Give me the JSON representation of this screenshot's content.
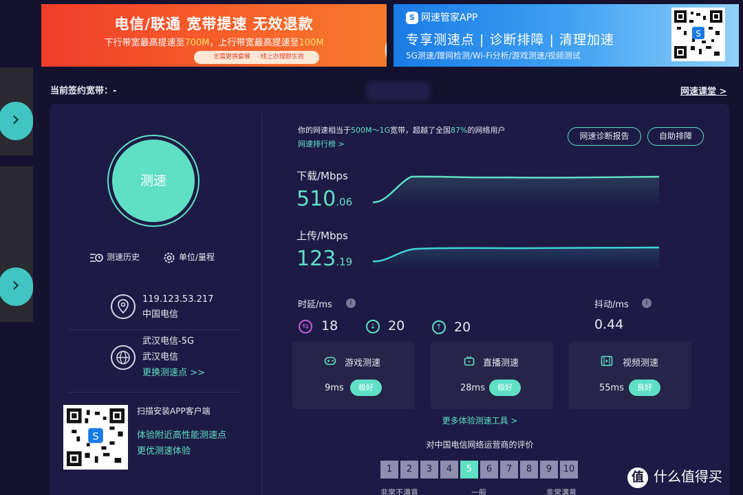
{
  "banner_left": {
    "title": "电信/联通 宽带提速 无效退款",
    "sub_prefix": "下行带宽最高提速至",
    "sub_down": "700M",
    "sub_mid": "，上行带宽最高提速至",
    "sub_up": "100M",
    "chips": "· 无需更换套餐　· 线上办理即生效"
  },
  "banner_right": {
    "app_name": "网速管家APP",
    "headline": "专享测速点 | 诊断排障 | 清理加速",
    "sub": "5G测速/蹭网检测/Wi-Fi分析/游戏测速/视频测试"
  },
  "header": {
    "contract": "当前签约宽带：-",
    "course_link": "网速课堂 >"
  },
  "left": {
    "start_button": "测速",
    "history": "测速历史",
    "unit_range": "单位/量程",
    "ip": "119.123.53.217",
    "isp": "中国电信",
    "server_name": "武汉电信-5G",
    "server_isp": "武汉电信",
    "change_server": "更换测速点 >>",
    "scan_title": "扫描安装APP客户端",
    "scan_line1": "体验附近高性能测速点",
    "scan_line2": "更优测速体验"
  },
  "summary": {
    "pre": "你的网速相当于",
    "band": "500M～1G",
    "mid": "宽带，超越了全国",
    "pct": "87%",
    "post": "的网络用户",
    "rank_link": "网速排行榜 >",
    "report_button": "网速诊断报告",
    "fix_button": "自助排障"
  },
  "download": {
    "label": "下载/Mbps",
    "int": "510",
    "dec": ".06"
  },
  "upload": {
    "label": "上传/Mbps",
    "int": "123",
    "dec": ".19"
  },
  "latency": {
    "label": "时延/ms",
    "values": [
      "18",
      "20",
      "20"
    ],
    "jitter_label": "抖动/ms",
    "jitter": "0.44",
    "info": "i"
  },
  "tools": [
    {
      "name": "游戏测速",
      "value": "9ms",
      "rating": "极好"
    },
    {
      "name": "直播测速",
      "value": "28ms",
      "rating": "极好"
    },
    {
      "name": "视频测速",
      "value": "55ms",
      "rating": "良好"
    }
  ],
  "more_tools": "更多体验测速工具 >",
  "rating": {
    "title": "对中国电信网络运营商的评价",
    "scale": [
      "1",
      "2",
      "3",
      "4",
      "5",
      "6",
      "7",
      "8",
      "9",
      "10"
    ],
    "selected": 5,
    "low": "非常不满意",
    "mid": "一般",
    "high": "非常满意"
  },
  "watermark": {
    "glyph": "值",
    "text": "什么值得买"
  },
  "nav": {
    "arrow": "›"
  },
  "colors": {
    "accent": "#5fe0c5",
    "card": "#1d1b44",
    "page": "#14122f"
  }
}
